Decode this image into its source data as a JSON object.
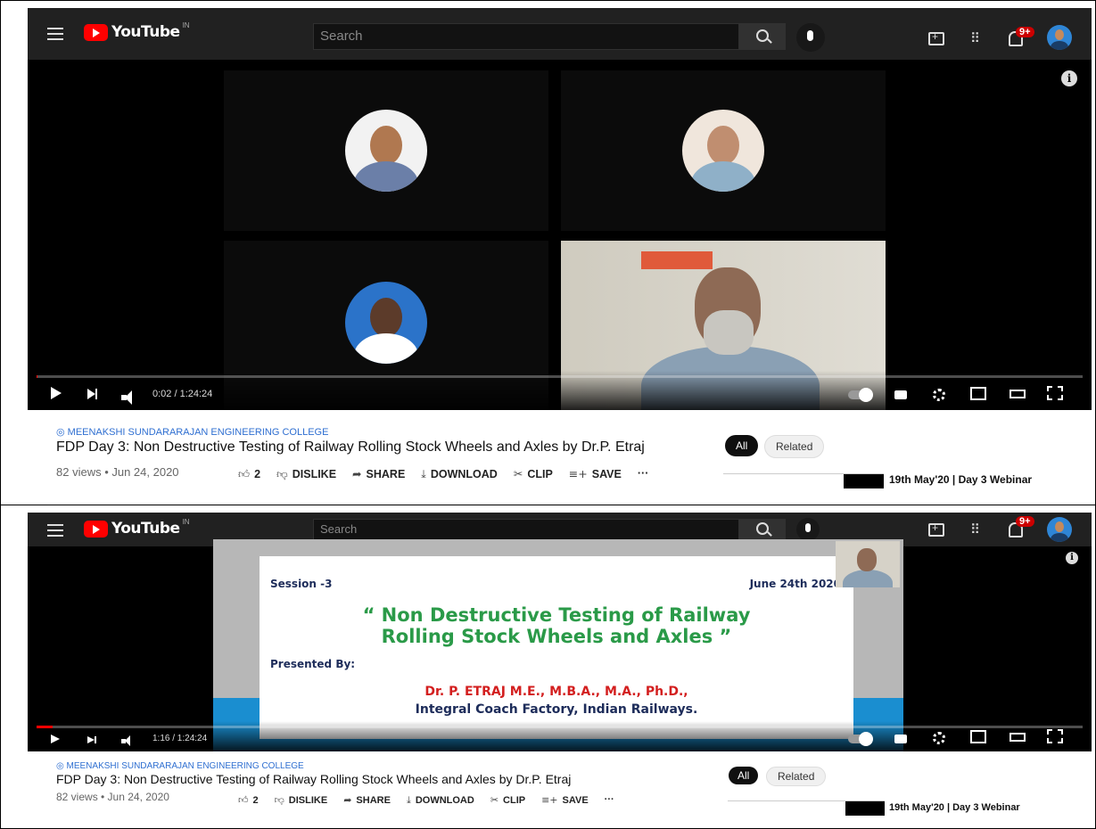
{
  "masthead": {
    "logo_text": "YouTube",
    "country_code": "IN",
    "search_placeholder": "Search",
    "notifications_badge": "9+"
  },
  "player1": {
    "time": "0:02 / 1:24:24",
    "progress_fraction": 0.0004
  },
  "player2": {
    "time": "1:16 / 1:24:24",
    "progress_fraction": 0.015,
    "slide": {
      "session": "Session -3",
      "date": "June 24th 2020",
      "title_line1": "“ Non Destructive Testing of Railway",
      "title_line2": "Rolling Stock Wheels and Axles ”",
      "presented_by": "Presented By:",
      "presenter": "Dr. P. ETRAJ M.E., M.B.A., M.A., Ph.D.,",
      "organization": "Integral Coach Factory, Indian Railways."
    }
  },
  "video": {
    "channel": "MEENAKSHI SUNDARARAJAN ENGINEERING COLLEGE",
    "title": "FDP Day 3: Non Destructive Testing of Railway Rolling Stock Wheels and Axles by Dr.P. Etraj",
    "meta": "82 views • Jun 24, 2020"
  },
  "actions": {
    "like_count": "2",
    "dislike": "DISLIKE",
    "share": "SHARE",
    "download": "DOWNLOAD",
    "clip": "CLIP",
    "save": "SAVE",
    "more": "···"
  },
  "chips": {
    "all": "All",
    "related": "Related"
  },
  "related": {
    "title": "19th May'20 | Day 3 Webinar"
  }
}
